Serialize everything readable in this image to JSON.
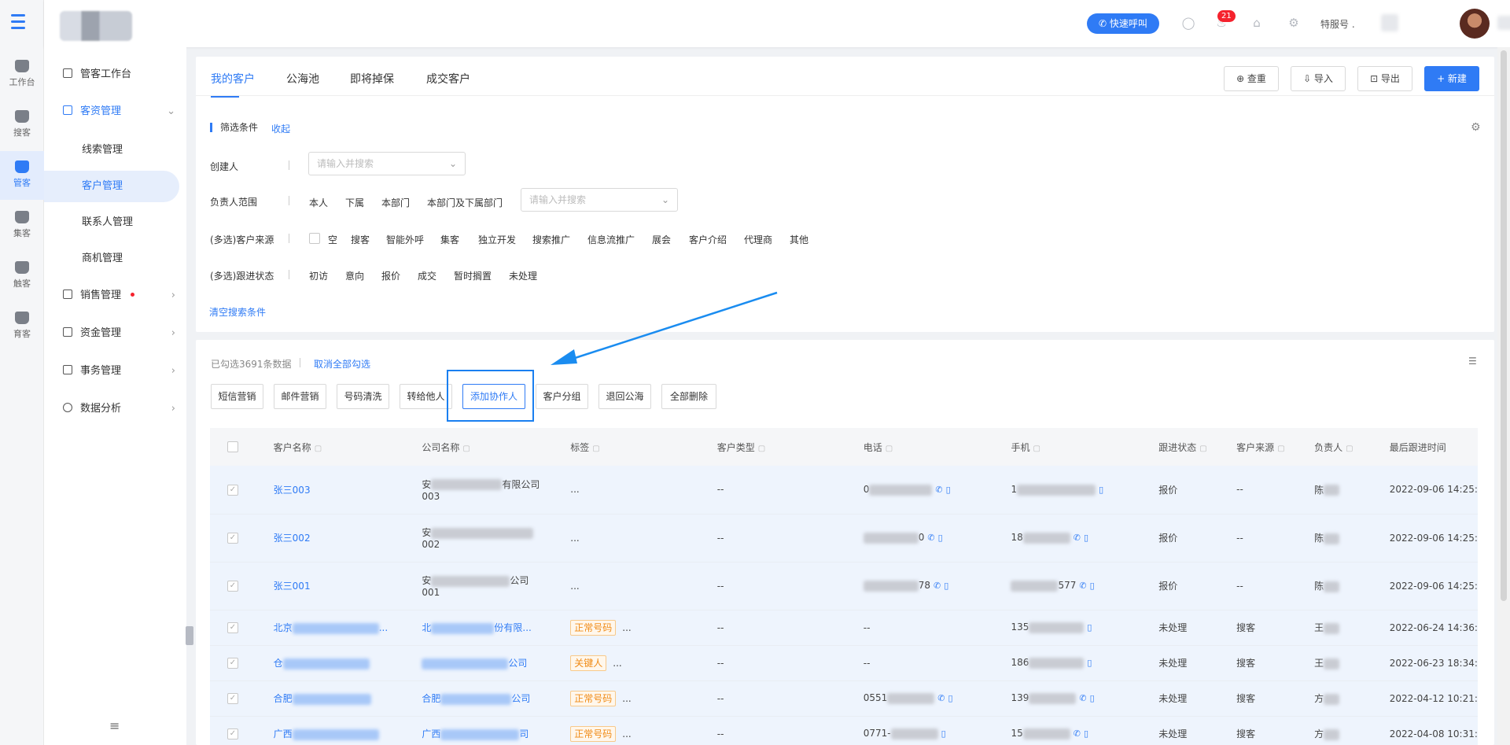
{
  "header": {
    "call_button": "快速呼叫",
    "notification_count": "21",
    "service_label": "特服号 ."
  },
  "rail": [
    {
      "label": "工作台"
    },
    {
      "label": "搜客"
    },
    {
      "label": "管客"
    },
    {
      "label": "集客"
    },
    {
      "label": "触客"
    },
    {
      "label": "育客"
    }
  ],
  "sidebar": {
    "workbench": "管客工作台",
    "asset_mgmt": "客资管理",
    "subs": [
      "线索管理",
      "客户管理",
      "联系人管理",
      "商机管理"
    ],
    "sales_mgmt": "销售管理",
    "fund_mgmt": "资金管理",
    "affairs_mgmt": "事务管理",
    "data_analysis": "数据分析"
  },
  "tabs": [
    "我的客户",
    "公海池",
    "即将掉保",
    "成交客户"
  ],
  "header_buttons": {
    "dup_check": "⊕ 查重",
    "import": "⇩ 导入",
    "export": "⊡ 导出",
    "new": "+ 新建"
  },
  "filters": {
    "title": "筛选条件",
    "collapse": "收起",
    "creator_label": "创建人",
    "search_placeholder": "请输入并搜索",
    "owner_label": "负责人范围",
    "owner_opts": [
      "本人",
      "下属",
      "本部门",
      "本部门及下属部门"
    ],
    "source_label": "(多选)客户来源",
    "source_opts": [
      "空",
      "搜客",
      "智能外呼",
      "集客",
      "独立开发",
      "搜索推广",
      "信息流推广",
      "展会",
      "客户介绍",
      "代理商",
      "其他"
    ],
    "follow_label": "(多选)跟进状态",
    "follow_opts": [
      "初访",
      "意向",
      "报价",
      "成交",
      "暂时搁置",
      "未处理"
    ],
    "clear": "清空搜索条件"
  },
  "selection": {
    "count_text": "已勾选3691条数据",
    "cancel_all": "取消全部勾选"
  },
  "actions": [
    "短信营销",
    "邮件营销",
    "号码清洗",
    "转给他人",
    "添加协作人",
    "客户分组",
    "退回公海",
    "全部删除"
  ],
  "table": {
    "columns": [
      "客户名称",
      "公司名称",
      "标签",
      "客户类型",
      "电话",
      "手机",
      "跟进状态",
      "客户来源",
      "负责人",
      "最后跟进时间"
    ],
    "rows": [
      {
        "name": "张三003",
        "company1": "安",
        "company2": "有限公司",
        "company_line2": "003",
        "tag": "...",
        "tag_extra": "",
        "type": "--",
        "phone": "0",
        "mobile": "1",
        "status": "报价",
        "source": "--",
        "owner": "陈",
        "time": "2022-09-06 14:25:"
      },
      {
        "name": "张三002",
        "company1": "安",
        "company2": "",
        "company_line2": "002",
        "tag": "...",
        "tag_extra": "",
        "type": "--",
        "phone": "0",
        "mobile": "18",
        "status": "报价",
        "source": "--",
        "owner": "陈",
        "time": "2022-09-06 14:25:"
      },
      {
        "name": "张三001",
        "company1": "安",
        "company2": "公司",
        "company_line2": "001",
        "tag": "...",
        "tag_extra": "",
        "type": "--",
        "phone": "78",
        "mobile": "577",
        "status": "报价",
        "source": "--",
        "owner": "陈",
        "time": "2022-09-06 14:25:"
      },
      {
        "name": "北京",
        "company1": "北",
        "company2": "份有限...",
        "company_line2": "",
        "tag": "正常号码",
        "tag_extra": "...",
        "type": "--",
        "phone": "--",
        "mobile": "135",
        "status": "未处理",
        "source": "搜客",
        "owner": "王",
        "time": "2022-06-24 14:36:"
      },
      {
        "name": "仓",
        "company1": "",
        "company2": "公司",
        "company_line2": "",
        "tag": "关键人",
        "tag_extra": "...",
        "type": "--",
        "phone": "--",
        "mobile": "186",
        "status": "未处理",
        "source": "搜客",
        "owner": "王",
        "time": "2022-06-23 18:34:"
      },
      {
        "name": "合肥",
        "company1": "合肥",
        "company2": "公司",
        "company_line2": "",
        "tag": "正常号码",
        "tag_extra": "...",
        "type": "--",
        "phone": "0551",
        "mobile": "139",
        "status": "未处理",
        "source": "搜客",
        "owner": "方",
        "time": "2022-04-12 10:21:"
      },
      {
        "name": "广西",
        "company1": "广西",
        "company2": "司",
        "company_line2": "",
        "tag": "正常号码",
        "tag_extra": "...",
        "type": "--",
        "phone": "0771-",
        "mobile": "15",
        "status": "未处理",
        "source": "搜客",
        "owner": "方",
        "time": "2022-04-08 10:31:"
      }
    ]
  },
  "colors": {
    "accent": "#2f7bf5",
    "highlight_box": "#1a7ff0",
    "tag_orange": "#f08b16",
    "danger": "#f5222d"
  }
}
